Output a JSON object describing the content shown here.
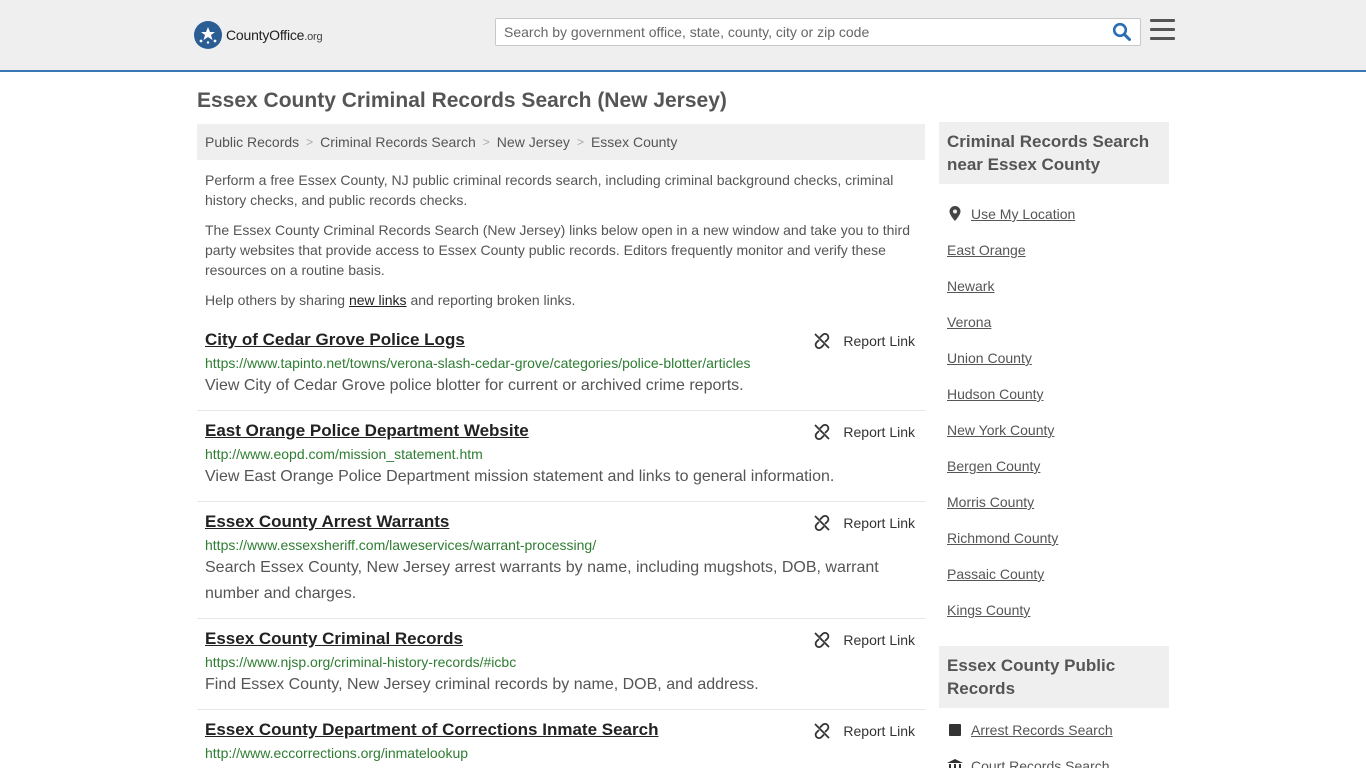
{
  "header": {
    "logo_text": "CountyOffice",
    "logo_tld": ".org",
    "search_placeholder": "Search by government office, state, county, city or zip code"
  },
  "page_title": "Essex County Criminal Records Search (New Jersey)",
  "breadcrumb": [
    "Public Records",
    "Criminal Records Search",
    "New Jersey",
    "Essex County"
  ],
  "breadcrumb_separator": ">",
  "intro": {
    "p1": "Perform a free Essex County, NJ public criminal records search, including criminal background checks, criminal history checks, and public records checks.",
    "p2": "The Essex County Criminal Records Search (New Jersey) links below open in a new window and take you to third party websites that provide access to Essex County public records. Editors frequently monitor and verify these resources on a routine basis.",
    "p3_before": "Help others by sharing ",
    "p3_link": "new links",
    "p3_after": " and reporting broken links."
  },
  "report_label": "Report Link",
  "results": [
    {
      "title": "City of Cedar Grove Police Logs",
      "url": "https://www.tapinto.net/towns/verona-slash-cedar-grove/categories/police-blotter/articles",
      "desc": "View City of Cedar Grove police blotter for current or archived crime reports."
    },
    {
      "title": "East Orange Police Department Website",
      "url": "http://www.eopd.com/mission_statement.htm",
      "desc": "View East Orange Police Department mission statement and links to general information."
    },
    {
      "title": "Essex County Arrest Warrants",
      "url": "https://www.essexsheriff.com/laweservices/warrant-processing/",
      "desc": "Search Essex County, New Jersey arrest warrants by name, including mugshots, DOB, warrant number and charges."
    },
    {
      "title": "Essex County Criminal Records",
      "url": "https://www.njsp.org/criminal-history-records/#icbc",
      "desc": "Find Essex County, New Jersey criminal records by name, DOB, and address."
    },
    {
      "title": "Essex County Department of Corrections Inmate Search",
      "url": "http://www.eccorrections.org/inmatelookup",
      "desc": ""
    }
  ],
  "sidebar": {
    "nearby_heading": "Criminal Records Search near Essex County",
    "use_location": "Use My Location",
    "nearby": [
      "East Orange",
      "Newark",
      "Verona",
      "Union County",
      "Hudson County",
      "New York County",
      "Bergen County",
      "Morris County",
      "Richmond County",
      "Passaic County",
      "Kings County"
    ],
    "public_heading": "Essex County Public Records",
    "public_links": [
      {
        "label": "Arrest Records Search",
        "icon": "square-icon"
      },
      {
        "label": "Court Records Search",
        "icon": "courthouse-icon"
      }
    ]
  },
  "colors": {
    "header_bg": "#efefef",
    "header_border": "#3a78b5",
    "url_green": "#2e7d32",
    "search_icon": "#2a6fb5"
  }
}
